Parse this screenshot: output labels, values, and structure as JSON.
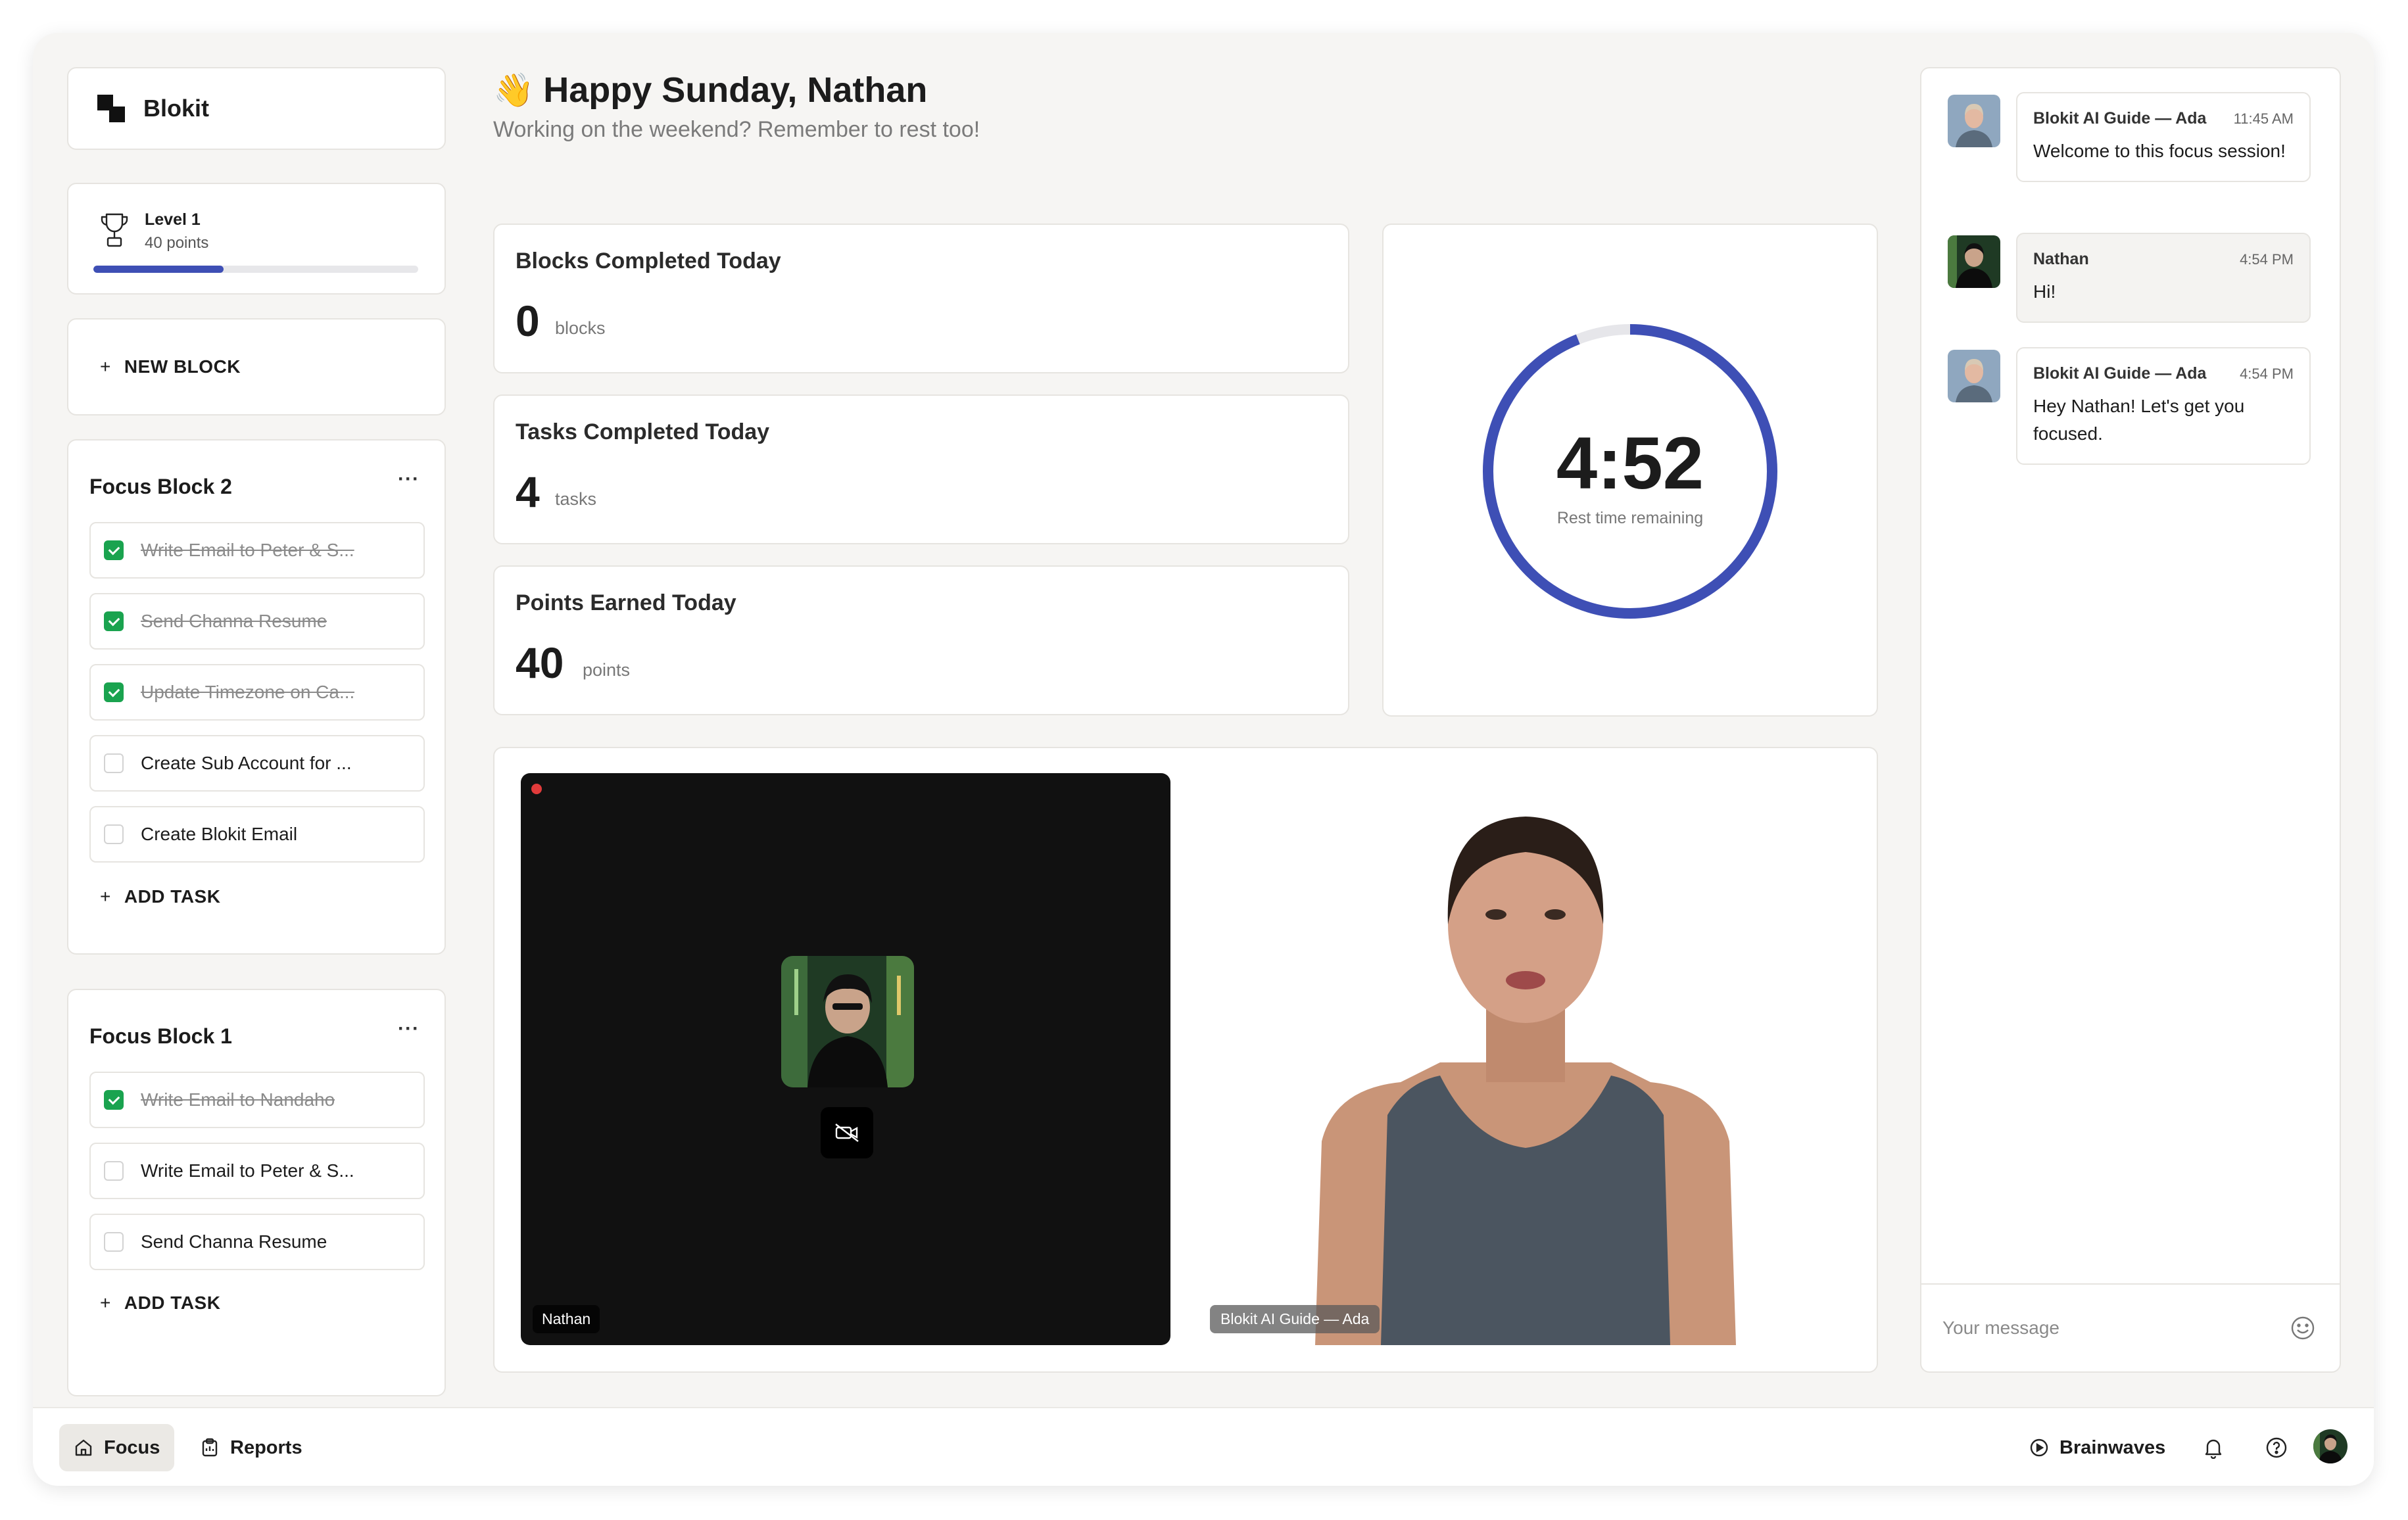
{
  "app": {
    "name": "Blokit"
  },
  "level": {
    "title": "Level 1",
    "points": "40 points",
    "progress": 0.4
  },
  "new_block_label": "NEW BLOCK",
  "blocks": [
    {
      "title": "Focus Block 2",
      "more": "···",
      "add_task_label": "ADD TASK",
      "tasks": [
        {
          "label": "Write Email to Peter & S...",
          "done": true
        },
        {
          "label": "Send Channa Resume",
          "done": true
        },
        {
          "label": "Update Timezone on Ca...",
          "done": true
        },
        {
          "label": "Create Sub Account for ...",
          "done": false
        },
        {
          "label": "Create Blokit Email",
          "done": false
        }
      ]
    },
    {
      "title": "Focus Block 1",
      "more": "···",
      "add_task_label": "ADD TASK",
      "tasks": [
        {
          "label": "Write Email to Nandaho",
          "done": true
        },
        {
          "label": "Write Email to Peter & S...",
          "done": false
        },
        {
          "label": "Send Channa Resume",
          "done": false
        }
      ]
    }
  ],
  "greeting": {
    "emoji": "👋",
    "title": "Happy Sunday, Nathan",
    "subtitle": "Working on the weekend? Remember to rest too!"
  },
  "stats": [
    {
      "title": "Blocks Completed Today",
      "value": "0",
      "unit": "blocks"
    },
    {
      "title": "Tasks Completed Today",
      "value": "4",
      "unit": "tasks"
    },
    {
      "title": "Points Earned Today",
      "value": "40",
      "unit": "points"
    }
  ],
  "timer": {
    "value": "4:52",
    "label": "Rest time remaining",
    "progress": 0.94,
    "accent": "#3e4fb5"
  },
  "video": {
    "user_name": "Nathan",
    "ai_name": "Blokit AI Guide — Ada"
  },
  "chat": {
    "messages": [
      {
        "name": "Blokit AI Guide — Ada",
        "time": "11:45 AM",
        "text": "Welcome to this focus session!",
        "from": "ai"
      },
      {
        "name": "Nathan",
        "time": "4:54 PM",
        "text": "Hi!",
        "from": "user"
      },
      {
        "name": "Blokit AI Guide — Ada",
        "time": "4:54 PM",
        "text": "Hey Nathan! Let's get you focused.",
        "from": "ai"
      }
    ],
    "input_placeholder": "Your message"
  },
  "nav": {
    "focus": "Focus",
    "reports": "Reports",
    "brainwaves": "Brainwaves"
  },
  "colors": {
    "accent": "#3e4fb5",
    "success": "#1aa34f",
    "recording": "#e13b3b"
  }
}
